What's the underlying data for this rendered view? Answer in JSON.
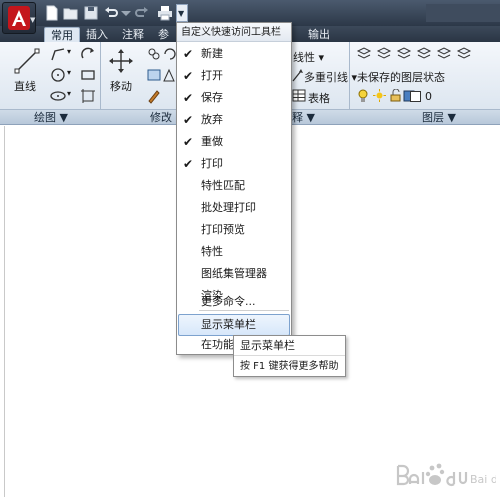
{
  "quick_access": {
    "icons": [
      "new-icon",
      "open-icon",
      "save-icon",
      "undo-icon",
      "redo-icon",
      "print-icon",
      "dropdown-arrow-icon"
    ]
  },
  "ribbon": {
    "tabs": [
      "常用",
      "插入",
      "注释",
      "参",
      "输出"
    ],
    "active_tab": "常用",
    "draw": {
      "line_label": "直线",
      "panel_label": "绘图 ▼"
    },
    "modify": {
      "move_label": "移动",
      "panel_label": "修改"
    },
    "annotation": {
      "linear_label": "线性 ▾",
      "multileader_label": "多重引线 ▾",
      "table_label": "表格",
      "panel_label": "释 ▼"
    },
    "layers": {
      "state_label": "未保存的图层状态",
      "layer_value": "0",
      "panel_label": "图层 ▼"
    }
  },
  "menu": {
    "header": "自定义快速访问工具栏",
    "items": [
      {
        "label": "新建",
        "checked": "✔"
      },
      {
        "label": "打开",
        "checked": "✔"
      },
      {
        "label": "保存",
        "checked": "✔"
      },
      {
        "label": "放弃",
        "checked": "✔"
      },
      {
        "label": "重做",
        "checked": "✔"
      },
      {
        "label": "打印",
        "checked": "✔"
      },
      {
        "label": "特性匹配",
        "checked": ""
      },
      {
        "label": "批处理打印",
        "checked": ""
      },
      {
        "label": "打印预览",
        "checked": ""
      },
      {
        "label": "特性",
        "checked": ""
      },
      {
        "label": "图纸集管理器",
        "checked": ""
      },
      {
        "label": "渲染",
        "checked": ""
      }
    ],
    "more_commands": "更多命令...",
    "show_menubar": "显示菜单栏",
    "ribbon_below": "在功能"
  },
  "tooltip": {
    "title": "显示菜单栏",
    "help": "按 F1 键获得更多帮助"
  },
  "watermark": {
    "brand": "Bai du 经验"
  },
  "colors": {
    "title_bar": "#2c3848",
    "ribbon": "#dde6f0",
    "menu_highlight": "#d7e7fa",
    "app_logo": "#c4161c"
  }
}
